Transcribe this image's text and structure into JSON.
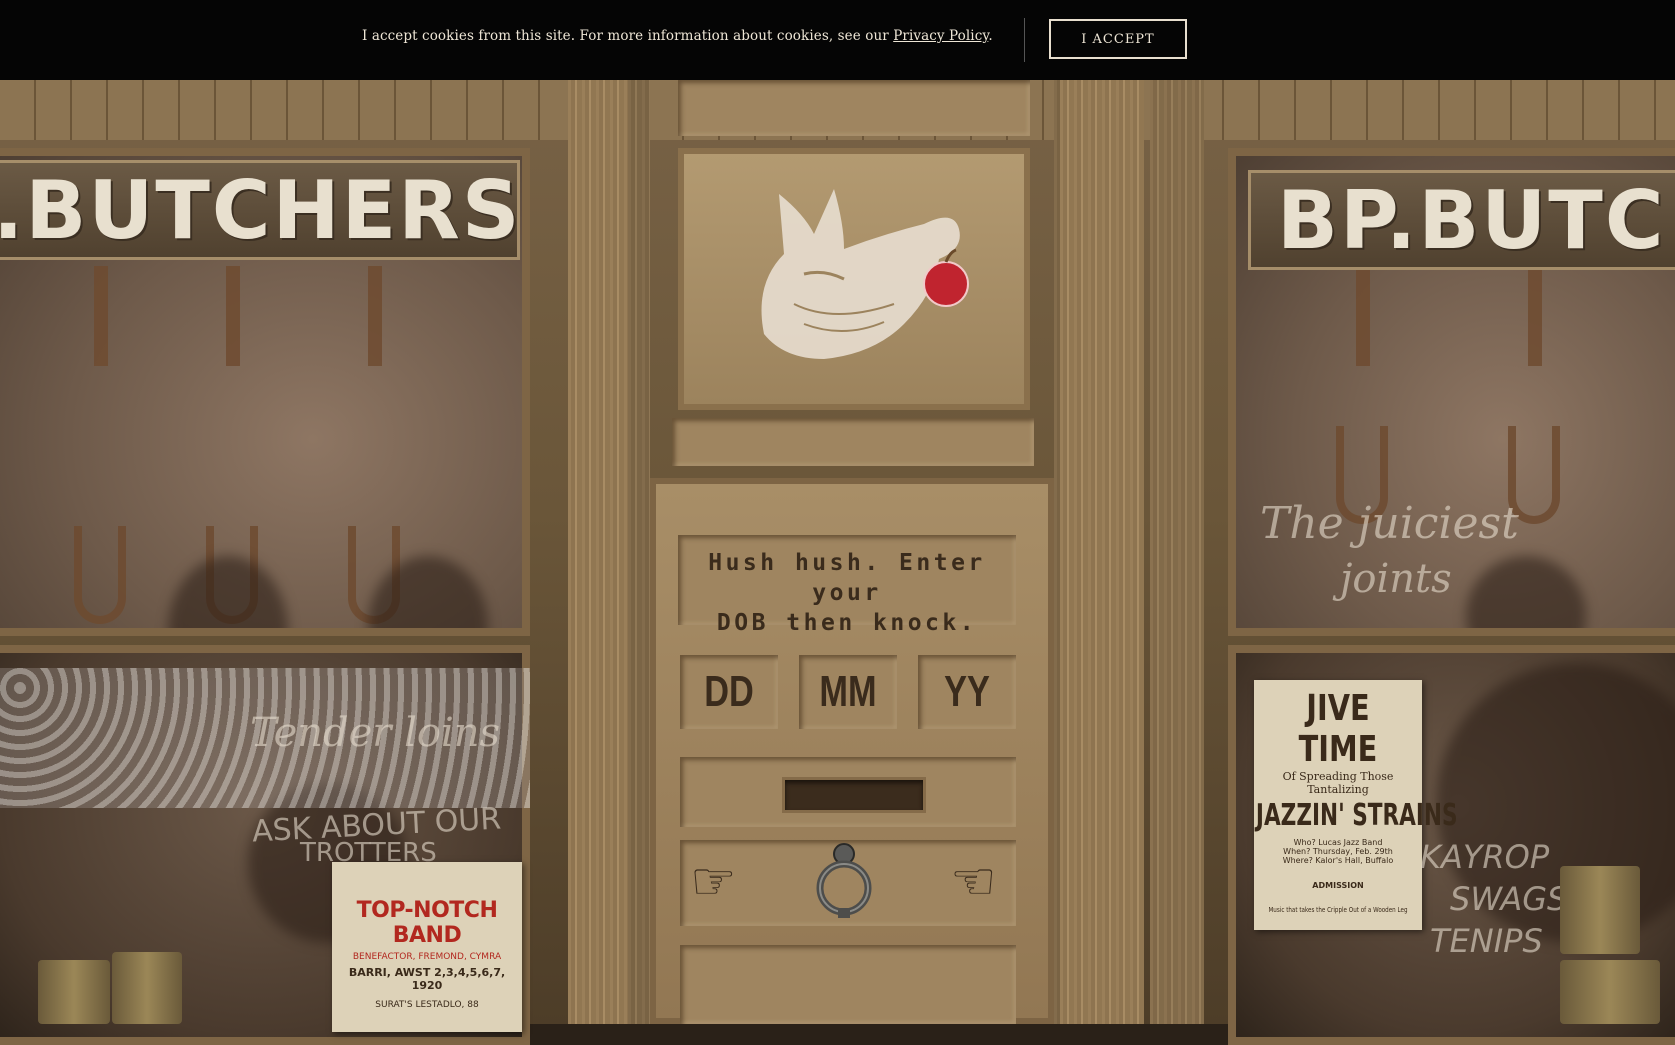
{
  "cookie_banner": {
    "text": "I accept cookies from this site. For more information about cookies, see our ",
    "link_label": "Privacy Policy",
    "suffix": ".",
    "accept_label": "I ACCEPT"
  },
  "left_window": {
    "sign": ".BUTCHERS",
    "script_text": "Tender loins",
    "chalk_text_1": "ASK ABOUT OUR",
    "chalk_text_2": "TROTTERS",
    "poster_title": "TOP-NOTCH BAND",
    "poster_line_1": "BENEFACTOR, FREMOND, CYMRA",
    "poster_line_2": "BARRI, AWST 2,3,4,5,6,7, 1920",
    "poster_line_3": "SURAT'S LESTADLO, 88"
  },
  "right_window": {
    "sign": "BP.BUTC",
    "script_line_1": "The juiciest",
    "script_line_2": "joints",
    "chalk_1": "KAYROP",
    "chalk_2": "SWAGS",
    "chalk_3": "TENIPS",
    "poster_title": "JIVE TIME",
    "poster_sub_1": "Of Spreading Those",
    "poster_sub_2": "Tantalizing",
    "poster_big": "JAZZIN' STRAINS",
    "poster_small_1": "Who? Lucas Jazz Band",
    "poster_small_2": "When? Thursday, Feb. 29th",
    "poster_small_3": "Where? Kalor's Hall, Buffalo",
    "poster_small_4": "ADMISSION",
    "poster_small_5": "Music that takes the Cripple Out of a Wooden Leg"
  },
  "door": {
    "hush_line_1": "Hush hush. Enter your",
    "hush_line_2": "DOB then knock.",
    "dob_day": "DD",
    "dob_month": "MM",
    "dob_year": "YY"
  },
  "colors": {
    "banner_bg": "#050505",
    "door_ink": "#3a2b1c",
    "apple_red": "#c0242f"
  },
  "icons": {
    "logo": "pig-head-with-apple-icon",
    "knocker": "door-knocker-icon",
    "hand_left": "pointing-hand-right-icon",
    "hand_right": "pointing-hand-left-icon"
  }
}
